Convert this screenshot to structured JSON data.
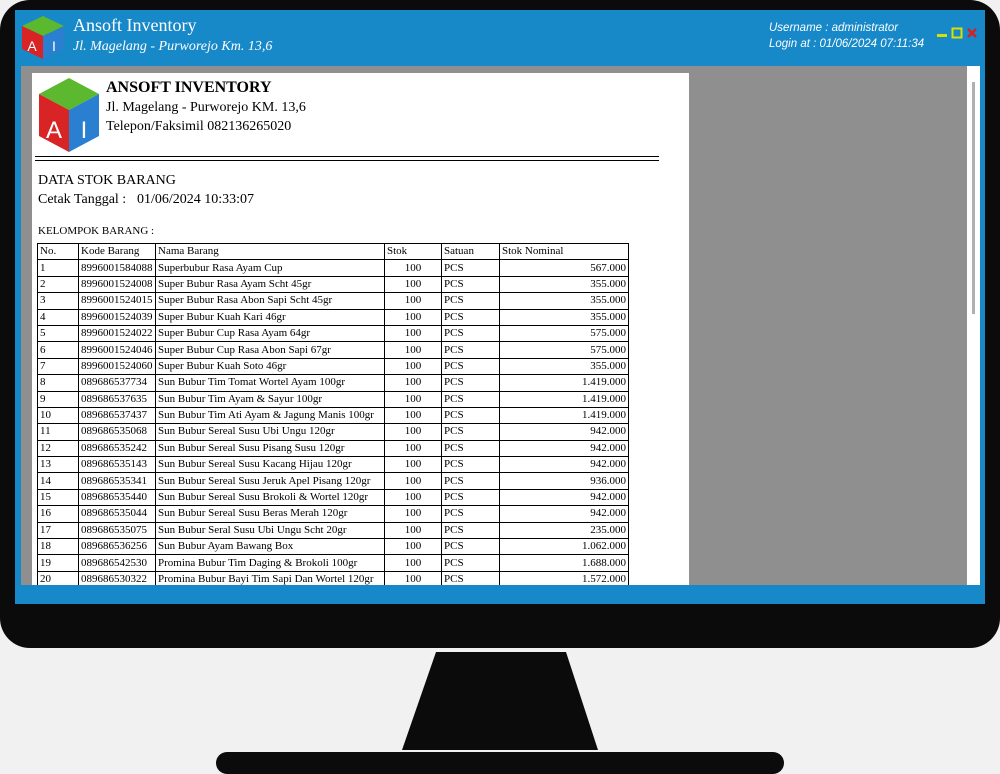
{
  "app": {
    "title": "Ansoft Inventory",
    "address": "Jl. Magelang - Purworejo Km. 13,6",
    "logo_letters": [
      "A",
      "I"
    ],
    "colors": {
      "titlebar": "#1788c8",
      "workspace": "#8f8f8f",
      "close": "#d82020",
      "minmax": "#d8e000"
    }
  },
  "session": {
    "username_line": "Username : administrator",
    "login_line": "Login at : 01/06/2024 07:11:34"
  },
  "window_controls": {
    "minimize": "▬",
    "maximize": "□",
    "close": "✕"
  },
  "report": {
    "company": "ANSOFT INVENTORY",
    "address": "Jl. Magelang - Purworejo KM. 13,6",
    "phone": "Telepon/Faksimil 082136265020",
    "title": "DATA STOK BARANG",
    "date_label": "Cetak Tanggal :",
    "date_value": "01/06/2024 10:33:07",
    "group_label": "KELOMPOK BARANG :",
    "columns": [
      "No.",
      "Kode Barang",
      "Nama Barang",
      "Stok",
      "Satuan",
      "Stok Nominal"
    ],
    "rows": [
      [
        "1",
        "8996001584088",
        "Superbubur Rasa Ayam Cup",
        "100",
        "PCS",
        "567.000"
      ],
      [
        "2",
        "8996001524008",
        "Super Bubur Rasa Ayam Scht 45gr",
        "100",
        "PCS",
        "355.000"
      ],
      [
        "3",
        "8996001524015",
        "Super Bubur Rasa Abon Sapi Scht 45gr",
        "100",
        "PCS",
        "355.000"
      ],
      [
        "4",
        "8996001524039",
        "Super Bubur Kuah Kari 46gr",
        "100",
        "PCS",
        "355.000"
      ],
      [
        "5",
        "8996001524022",
        "Super Bubur Cup Rasa Ayam 64gr",
        "100",
        "PCS",
        "575.000"
      ],
      [
        "6",
        "8996001524046",
        "Super Bubur Cup Rasa Abon Sapi 67gr",
        "100",
        "PCS",
        "575.000"
      ],
      [
        "7",
        "8996001524060",
        "Super  Bubur Kuah Soto 46gr",
        "100",
        "PCS",
        "355.000"
      ],
      [
        "8",
        "089686537734",
        "Sun Bubur Tim Tomat Wortel Ayam 100gr",
        "100",
        "PCS",
        "1.419.000"
      ],
      [
        "9",
        "089686537635",
        "Sun Bubur Tim Ayam & Sayur 100gr",
        "100",
        "PCS",
        "1.419.000"
      ],
      [
        "10",
        "089686537437",
        "Sun Bubur Tim Ati Ayam & Jagung Manis 100gr",
        "100",
        "PCS",
        "1.419.000"
      ],
      [
        "11",
        "089686535068",
        "Sun Bubur Sereal Susu Ubi Ungu 120gr",
        "100",
        "PCS",
        "942.000"
      ],
      [
        "12",
        "089686535242",
        "Sun Bubur Sereal Susu Pisang Susu 120gr",
        "100",
        "PCS",
        "942.000"
      ],
      [
        "13",
        "089686535143",
        "Sun Bubur Sereal Susu Kacang Hijau 120gr",
        "100",
        "PCS",
        "942.000"
      ],
      [
        "14",
        "089686535341",
        "Sun Bubur Sereal Susu Jeruk Apel Pisang 120gr",
        "100",
        "PCS",
        "936.000"
      ],
      [
        "15",
        "089686535440",
        "Sun Bubur Sereal Susu Brokoli & Wortel 120gr",
        "100",
        "PCS",
        "942.000"
      ],
      [
        "16",
        "089686535044",
        "Sun Bubur Sereal Susu Beras Merah 120gr",
        "100",
        "PCS",
        "942.000"
      ],
      [
        "17",
        "089686535075",
        "Sun Bubur Seral Susu Ubi Ungu Scht 20gr",
        "100",
        "PCS",
        "235.000"
      ],
      [
        "18",
        "089686536256",
        "Sun Bubur Ayam Bawang Box",
        "100",
        "PCS",
        "1.062.000"
      ],
      [
        "19",
        "089686542530",
        "Promina Bubur Tim Daging & Brokoli 100gr",
        "100",
        "PCS",
        "1.688.000"
      ],
      [
        "20",
        "089686530322",
        "Promina Bubur Bayi Tim Sapi Dan Wortel 120gr",
        "100",
        "PCS",
        "1.572.000"
      ]
    ]
  }
}
